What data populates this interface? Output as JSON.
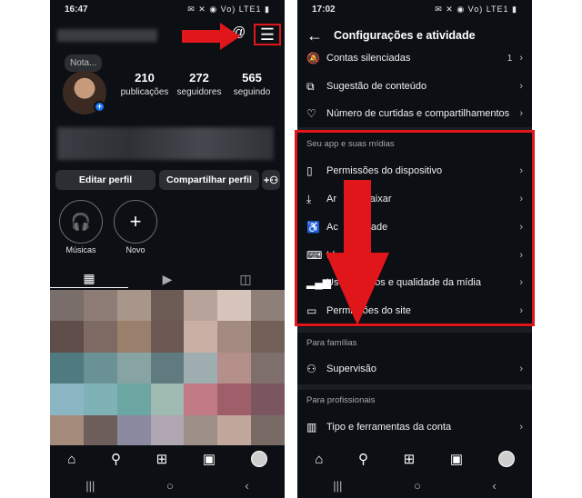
{
  "left": {
    "status": {
      "time": "16:47",
      "icons": "✉ ✕ ◉ Vo) LTE1 ▮"
    },
    "note": "Nota...",
    "stats": [
      {
        "value": "210",
        "label": "publicações"
      },
      {
        "value": "272",
        "label": "seguidores"
      },
      {
        "value": "565",
        "label": "seguindo"
      }
    ],
    "buttons": {
      "edit": "Editar perfil",
      "share": "Compartilhar perfil"
    },
    "highlights": [
      {
        "label": "Músicas"
      },
      {
        "label": "Novo"
      }
    ]
  },
  "right": {
    "status": {
      "time": "17:02",
      "icons": "✉ ✕ ◉ Vo) LTE1 ▮"
    },
    "title": "Configurações e atividade",
    "rows_top": [
      {
        "label": "Contas silenciadas",
        "count": "1"
      },
      {
        "label": "Sugestão de conteúdo"
      },
      {
        "label": "Número de curtidas e compartilhamentos"
      }
    ],
    "section_app": "Seu app e suas mídias",
    "rows_app": [
      {
        "label": "Permissões do dispositivo"
      },
      {
        "label": "Arquivar e baixar",
        "visible": "Ar          baixar"
      },
      {
        "label": "Acessibilidade",
        "visible": "Ac         idade"
      },
      {
        "label": "Idioma",
        "visible": "Id"
      },
      {
        "label": "Uso de dados e qualidade da mídia",
        "visible": "Uso       ados e qualidade da mídia"
      },
      {
        "label": "Permissões do site"
      }
    ],
    "section_families": "Para famílias",
    "row_supervision": "Supervisão",
    "section_pros": "Para profissionais",
    "row_tools": "Tipo e ferramentas da conta"
  },
  "colors": {
    "accent_red": "#e0161b",
    "bg": "#0c0f14",
    "verified_blue": "#1877f2"
  },
  "pixel_colors": [
    "#7a6e6a",
    "#8e7d76",
    "#a9968a",
    "#6d5b55",
    "#b8a39a",
    "#d6c4bb",
    "#8f7f79",
    "#5e4d48",
    "#7d6b63",
    "#9a7f6d",
    "#6b5852",
    "#c9b0a4",
    "#a38a80",
    "#725f58",
    "#4f7a80",
    "#6a9196",
    "#88a3a3",
    "#5f7b80",
    "#9eaeb0",
    "#b58f8a",
    "#7f6f6c",
    "#8ab6c4",
    "#7eb2b7",
    "#6ca6a2",
    "#9fbab1",
    "#c27a86",
    "#a05e6a",
    "#7b5660",
    "#a48a7a",
    "#6d5e5b",
    "#8b8aa0",
    "#b0a6b2",
    "#9e8f88",
    "#c2a89c",
    "#7a6a66"
  ]
}
